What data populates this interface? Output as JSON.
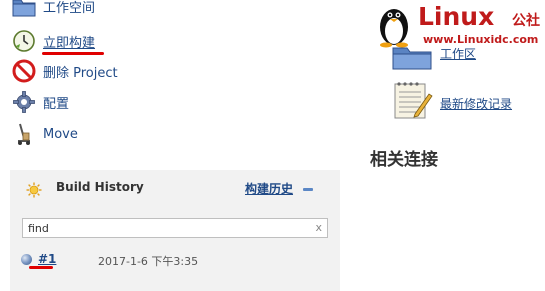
{
  "sidebar": {
    "items": [
      {
        "label": "工作空间",
        "icon": "folder-icon"
      },
      {
        "label": "立即构建",
        "icon": "build-clock-icon"
      },
      {
        "label": "删除 Project",
        "icon": "no-entry-icon"
      },
      {
        "label": "配置",
        "icon": "gear-icon"
      },
      {
        "label": "Move",
        "icon": "move-icon"
      }
    ]
  },
  "build_history": {
    "title": "Build History",
    "trend_label": "构建历史",
    "search_value": "find",
    "clear_symbol": "x",
    "builds": [
      {
        "number": "#1",
        "date": "2017-1-6 下午3:35"
      }
    ]
  },
  "main": {
    "workspace_link": "工作区",
    "changes_link": "最新修改记录",
    "section_title": "相关连接"
  },
  "watermark": {
    "brand": "Linux",
    "brand_suffix": "公社",
    "url": "www.Linuxidc.com"
  },
  "colors": {
    "link": "#204a87",
    "annotation_red": "#e00000",
    "watermark_red": "#c01b1b",
    "panel_bg": "#f2f2f2"
  }
}
